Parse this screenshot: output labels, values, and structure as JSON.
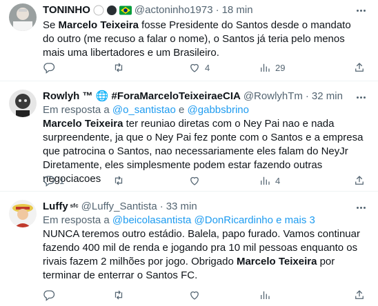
{
  "tweets": [
    {
      "name": "TONINHO",
      "handle": "@actoninho1973",
      "sep": "·",
      "time": "18 min",
      "text_parts": [
        {
          "t": "Se ",
          "b": false
        },
        {
          "t": "Marcelo Teixeira",
          "b": true
        },
        {
          "t": " fosse Presidente do Santos desde o mandato do outro (me recuso a falar o nome), o Santos  já teria pelo menos mais uma libertadores e um Brasileiro.",
          "b": false
        }
      ],
      "reply_count": "",
      "retweet_count": "",
      "like_count": "4",
      "view_count": "29"
    },
    {
      "name": "Rowlyh ™ 🌐 #ForaMarceloTeixeiraeCIA",
      "handle": "@RowlyhTm",
      "sep": "·",
      "time": "32 min",
      "reply_prefix": "Em resposta a ",
      "reply_users": [
        "@o_santistao",
        "@gabbsbrino"
      ],
      "reply_joiner": " e ",
      "text_parts": [
        {
          "t": "Marcelo Teixeira",
          "b": true
        },
        {
          "t": " ter reuniao diretas com o Ney Pai nao e nada surpreendente, ja que o Ney Pai fez ponte com o Santos e a empresa que patrocina o Santos, nao necessariamente eles falam do NeyJr Diretamente, eles simplesmente podem estar fazendo outras negociacoes",
          "b": false
        }
      ],
      "reply_count": "1",
      "retweet_count": "",
      "like_count": "",
      "view_count": "4"
    },
    {
      "name": "Luffy",
      "name_suffix": "ˢᶠᶜ",
      "handle": "@Luffy_Santista",
      "sep": "·",
      "time": "33 min",
      "reply_prefix": "Em resposta a ",
      "reply_users": [
        "@beicolasantista",
        "@DonRicardinho",
        "e mais 3"
      ],
      "reply_joiner": " ",
      "text_parts": [
        {
          "t": "NUNCA teremos outro estádio. Balela, papo furado. Vamos continuar fazendo 400 mil de renda e jogando pra 10 mil pessoas enquanto os rivais fazem 2 milhões por jogo. Obrigado ",
          "b": false
        },
        {
          "t": "Marcelo Teixeira",
          "b": true
        },
        {
          "t": " por terminar de enterrar o Santos FC.",
          "b": false
        }
      ],
      "reply_count": "",
      "retweet_count": "",
      "like_count": "",
      "view_count": ""
    }
  ],
  "colors": {
    "link": "#1d9bf0",
    "muted": "#536471",
    "text": "#0f1419",
    "border": "#eff3f4"
  },
  "icons": [
    "reply-icon",
    "retweet-icon",
    "like-icon",
    "views-icon",
    "more-icon"
  ]
}
